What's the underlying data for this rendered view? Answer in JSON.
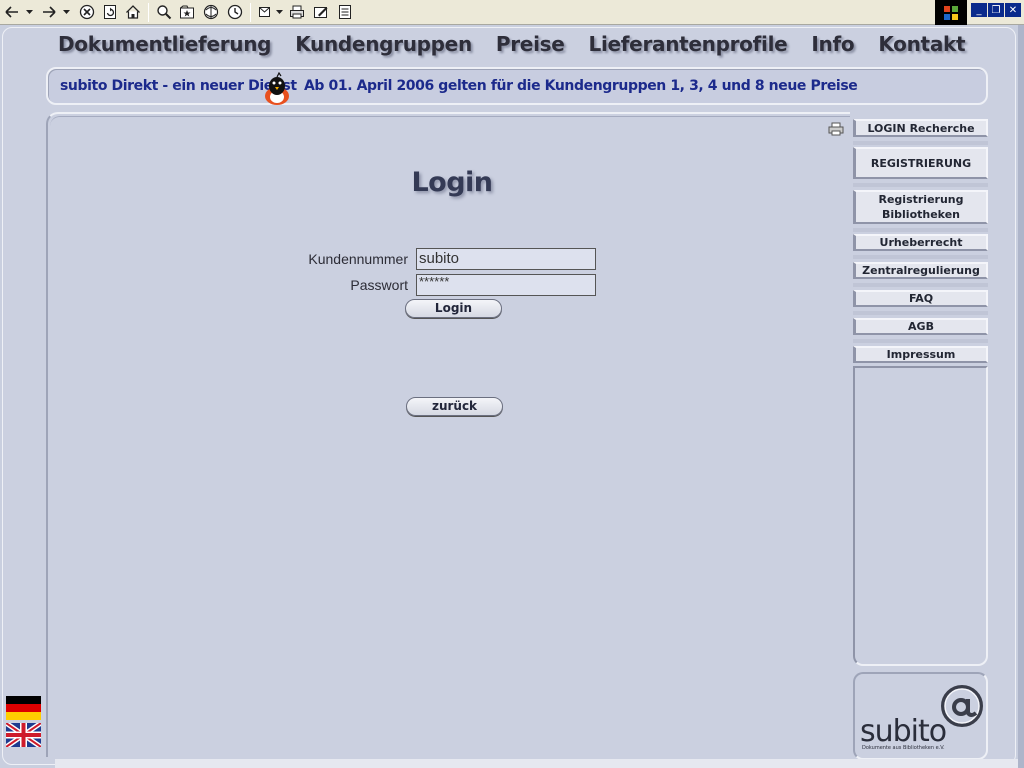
{
  "toolbar": {
    "items": [
      "back-icon",
      "forward-icon",
      "stop-icon",
      "refresh-icon",
      "home-icon",
      "search-icon",
      "favorites-icon",
      "media-icon",
      "history-icon",
      "mail-icon",
      "print-icon",
      "edit-icon",
      "discuss-icon"
    ]
  },
  "nav": {
    "items": [
      "Dokumentlieferung",
      "Kundengruppen",
      "Preise",
      "Lieferantenprofile",
      "Info",
      "Kontakt"
    ]
  },
  "ticker": {
    "left": "subito Direkt - ein neuer Dienst",
    "right": "Ab 01. April 2006  gelten für die Kundengruppen 1, 3, 4 und 8 neue Preise"
  },
  "login": {
    "title": "Login",
    "customer_label": "Kundennummer",
    "customer_value": "subito",
    "password_label": "Passwort",
    "password_value": "******",
    "submit_label": "Login",
    "back_label": "zurück"
  },
  "sidebar": {
    "items": [
      "LOGIN Recherche",
      "REGISTRIERUNG",
      "Registrierung Bibliotheken",
      "Urheberrecht",
      "Zentralregulierung",
      "FAQ",
      "AGB",
      "Impressum"
    ]
  },
  "logo": {
    "name": "subito",
    "tagline": "Dokumente aus Bibliotheken e.V."
  },
  "colors": {
    "accent": "#1c2a8c",
    "background": "#c9cfdf"
  }
}
